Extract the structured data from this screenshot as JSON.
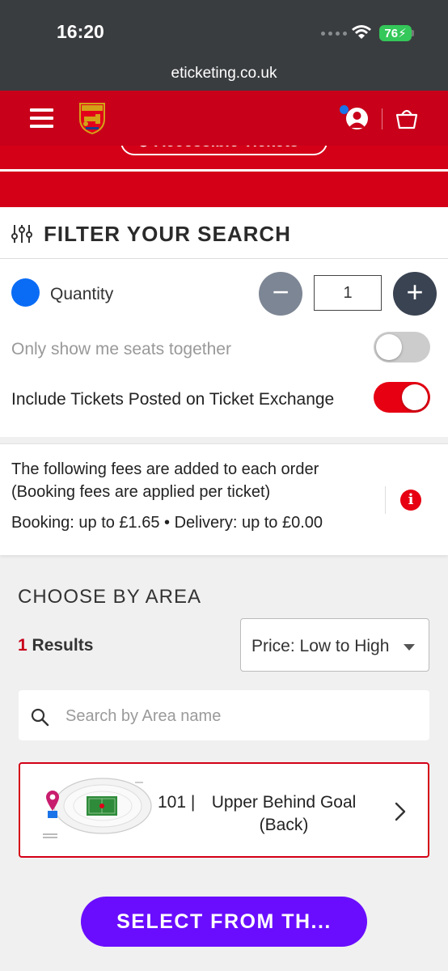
{
  "status_bar": {
    "time": "16:20",
    "battery": "76"
  },
  "browser": {
    "url": "eticketing.co.uk"
  },
  "header": {
    "brand_logo": "arsenal-crest",
    "accessible_tickets_label": "Accessible Tickets",
    "colors": {
      "primary": "#d40017"
    }
  },
  "filter": {
    "title": "FILTER YOUR SEARCH",
    "quantity_label": "Quantity",
    "quantity_value": "1",
    "seats_together_label": "Only show me seats together",
    "seats_together_on": false,
    "ticket_exchange_label": "Include Tickets Posted on Ticket Exchange",
    "ticket_exchange_on": true
  },
  "fees": {
    "line1": "The following fees are added to each order",
    "line2": "(Booking fees are applied per ticket)",
    "line3": "Booking: up to £1.65 • Delivery: up to £0.00"
  },
  "area": {
    "title": "CHOOSE BY AREA",
    "results_count": "1",
    "results_label": " Results",
    "sort_value": "Price: Low to High",
    "search_placeholder": "Search by Area name",
    "items": [
      {
        "code": "101 |",
        "name": "Upper Behind Goal (Back)"
      }
    ]
  },
  "cta": {
    "label": "SELECT FROM TH..."
  }
}
